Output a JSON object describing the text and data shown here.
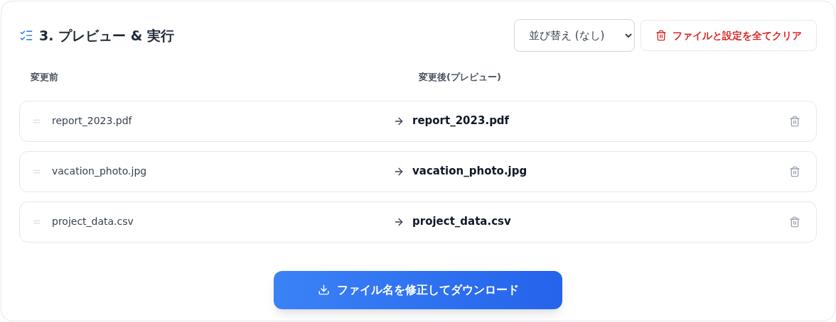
{
  "section": {
    "title": "3. プレビュー & 実行"
  },
  "sort_select": {
    "value": "並び替え (なし)"
  },
  "clear_button": {
    "label": "ファイルと設定を全てクリア"
  },
  "columns": [
    "変更前",
    "変更後(プレビュー)"
  ],
  "rows": [
    {
      "before": "report_2023.pdf",
      "after": "report_2023.pdf"
    },
    {
      "before": "vacation_photo.jpg",
      "after": "vacation_photo.jpg"
    },
    {
      "before": "project_data.csv",
      "after": "project_data.csv"
    }
  ],
  "download_button": {
    "label": "ファイル名を修正してダウンロード"
  }
}
